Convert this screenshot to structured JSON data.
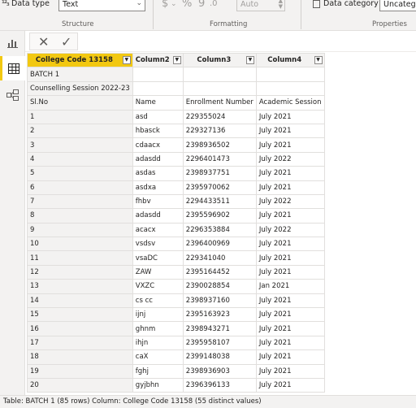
{
  "ribbon": {
    "structure": {
      "data_type_label": "Data type",
      "data_type_value": "Text",
      "group_label": "Structure"
    },
    "formatting": {
      "currency_symbol": "$",
      "percent_symbol": "%",
      "comma_symbol": "9",
      "auto_value": "Auto",
      "group_label": "Formatting"
    },
    "properties": {
      "data_category_label": "Data category",
      "data_category_value": "Uncatego",
      "group_label": "Properties"
    }
  },
  "rail": {
    "items": [
      {
        "icon": "report-view-icon"
      },
      {
        "icon": "data-view-icon",
        "active": true
      },
      {
        "icon": "model-view-icon"
      }
    ],
    "accent": "#f2c811"
  },
  "formula_bar": {
    "cancel_glyph": "✕",
    "commit_glyph": "✓"
  },
  "table": {
    "columns": [
      "College Code 13158",
      "Column2",
      "Column3",
      "Column4"
    ],
    "selected_column": 0,
    "rows": [
      [
        "BATCH 1",
        "",
        "",
        ""
      ],
      [
        "Counselling Session 2022-23",
        "",
        "",
        ""
      ],
      [
        "Sl.No",
        "Name",
        "Enrollment Number",
        "Academic Session"
      ],
      [
        "1",
        "asd",
        "229355024",
        "July 2021"
      ],
      [
        "2",
        "hbasck",
        "229327136",
        "July 2021"
      ],
      [
        "3",
        "cdaacx",
        "2398936502",
        "July 2021"
      ],
      [
        "4",
        "adasdd",
        "2296401473",
        "July 2022"
      ],
      [
        "5",
        "asdas",
        "2398937751",
        "July 2021"
      ],
      [
        "6",
        "asdxa",
        "2395970062",
        "July 2021"
      ],
      [
        "7",
        "fhbv",
        "2294433511",
        "July 2022"
      ],
      [
        "8",
        "adasdd",
        "2395596902",
        "July 2021"
      ],
      [
        "9",
        "acacx",
        "2296353884",
        "July 2022"
      ],
      [
        "10",
        "vsdsv",
        "2396400969",
        "July 2021"
      ],
      [
        "11",
        "vsaDC",
        "229341040",
        "July 2021"
      ],
      [
        "12",
        " ZAW",
        "2395164452",
        "July 2021"
      ],
      [
        "13",
        "VXZC",
        "2390028854",
        "Jan 2021"
      ],
      [
        "14",
        "cs cc",
        "2398937160",
        "July 2021"
      ],
      [
        "15",
        "ijnj",
        "2395163923",
        "July 2021"
      ],
      [
        "16",
        "ghnm",
        "2398943271",
        "July 2021"
      ],
      [
        "17",
        "ihjn",
        "2395958107",
        "July 2021"
      ],
      [
        "18",
        "caX",
        "2399148038",
        "July 2021"
      ],
      [
        "19",
        "fghj",
        "2398936903",
        "July 2021"
      ],
      [
        "20",
        "gyjbhn",
        "2396396133",
        "July 2021"
      ]
    ]
  },
  "status_bar": {
    "text": "Table: BATCH 1 (85 rows) Column: College Code 13158 (55 distinct values)"
  }
}
